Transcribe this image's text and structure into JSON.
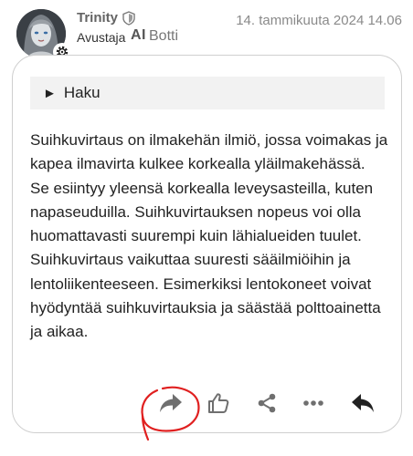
{
  "post": {
    "author": {
      "username": "Trinity",
      "user_title": "Avustaja",
      "ai_badge": "AI",
      "bot_label": "Botti"
    },
    "date": "14. tammikuuta 2024 14.06",
    "details_summary": "Haku",
    "body": "Suihkuvirtaus on ilmakehän ilmiö, jossa voimakas ja kapea ilmavirta kulkee korkealla yläilmakehässä. Se esiintyy yleensä korkealla leveysasteilla, kuten napaseuduilla. Suihkuvirtauksen nopeus voi olla huomattavasti suurempi kuin lähialueiden tuulet. Suihkuvirtaus vaikuttaa suuresti sääilmiöihin ja lentoliikenteeseen. Esimerkiksi lentokoneet voivat hyödyntää suihkuvirtauksia ja säästää polttoainetta ja aikaa."
  },
  "actions": [
    {
      "icon": "share-forward-icon"
    },
    {
      "icon": "like-icon"
    },
    {
      "icon": "share-icon"
    },
    {
      "icon": "more-icon"
    },
    {
      "icon": "reply-icon"
    }
  ],
  "colors": {
    "annotation": "#e02020",
    "icon": "#6f6f6f",
    "reply": "#222222"
  }
}
